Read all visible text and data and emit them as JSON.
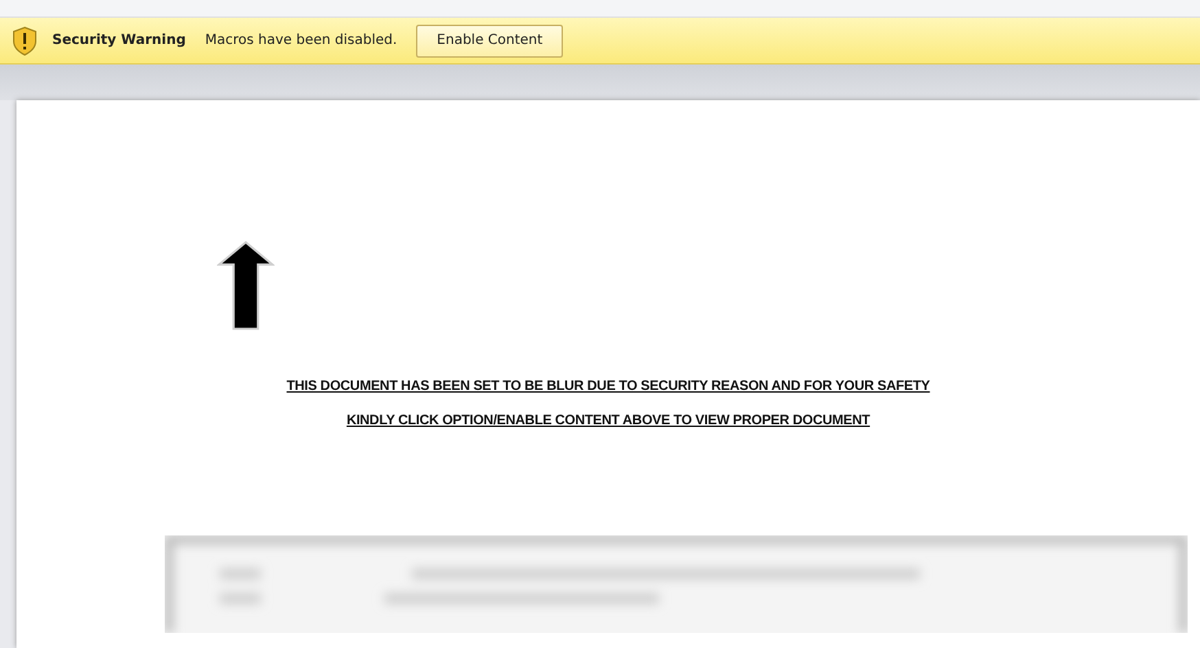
{
  "security_bar": {
    "title": "Security Warning",
    "message": "Macros have been disabled.",
    "button": "Enable Content"
  },
  "document": {
    "lines": [
      "THIS DOCUMENT HAS BEEN SET TO BE BLUR DUE TO SECURITY REASON AND FOR YOUR SAFETY",
      "KINDLY CLICK OPTION/ENABLE CONTENT ABOVE TO VIEW PROPER DOCUMENT"
    ]
  }
}
